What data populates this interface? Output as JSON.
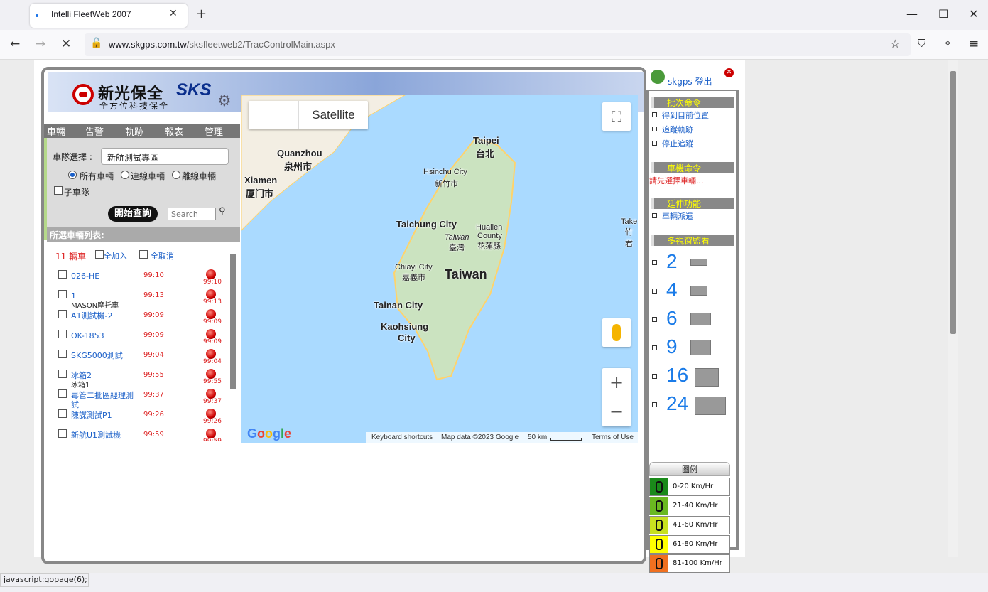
{
  "browser": {
    "tab_title": "Intelli FleetWeb 2007",
    "url_host": "www.skgps.com.tw",
    "url_path": "/sksfleetweb2/TracControlMain.aspx",
    "status_text": "javascript:gopage(6);"
  },
  "banner": {
    "logo_cn": "新光保全",
    "logo_en": "SKS",
    "logo_sub": "全方位科技保全"
  },
  "menu_tabs": [
    "車輛",
    "告警",
    "軌跡",
    "報表",
    "管理"
  ],
  "left": {
    "fleet_label": "車隊選擇 :",
    "fleet_value": "新航測試專區",
    "radio_all": "所有車輛",
    "radio_online": "連線車輛",
    "radio_offline": "離線車輛",
    "sub_fleet": "子車隊",
    "query_button": "開始查詢",
    "search_placeholder": "Search",
    "list_header": "所選車輛列表:",
    "count_text": "11 輛車",
    "add_all": "全加入",
    "cancel_all": "全取消"
  },
  "vehicles": [
    {
      "name": "026-HE",
      "sub": "",
      "time": "99:10"
    },
    {
      "name": "1",
      "sub": "MASON摩托車",
      "time": "99:13"
    },
    {
      "name": "A1測試機-2",
      "sub": "",
      "time": "99:09"
    },
    {
      "name": "OK-1853",
      "sub": "",
      "time": "99:09"
    },
    {
      "name": "SKG5000測試",
      "sub": "",
      "time": "99:04"
    },
    {
      "name": "冰箱2",
      "sub": "冰箱1",
      "time": "99:55"
    },
    {
      "name": "毒管二批區經理測試",
      "sub": "",
      "time": "99:37"
    },
    {
      "name": "陳謀測試P1",
      "sub": "",
      "time": "99:26"
    },
    {
      "name": "新航U1測試機",
      "sub": "",
      "time": "99:59"
    }
  ],
  "map": {
    "type_button": "Satellite",
    "labels": {
      "taipei": "Taipei",
      "taipei_cn": "台北",
      "quanzhou": "Quanzhou",
      "quanzhou_cn": "泉州市",
      "xiamen": "Xiamen",
      "xiamen_cn": "厦门市",
      "hsinchu": "Hsinchu City",
      "hsinchu_cn": "新竹市",
      "taichung": "Taichung City",
      "taiwan_small": "Taiwan",
      "taiwan_cn": "臺灣",
      "hualien": "Hualien",
      "hualien2": "County",
      "hualien_cn": "花蓮縣",
      "chiayi": "Chiayi City",
      "chiayi_cn": "嘉義市",
      "taiwan": "Taiwan",
      "tainan": "Tainan City",
      "kaohsiung": "Kaohsiung",
      "kaohsiung2": "City",
      "take": "Take",
      "take_cn": "竹君"
    },
    "footer": {
      "shortcuts": "Keyboard shortcuts",
      "data": "Map data ©2023 Google",
      "scale": "50 km",
      "terms": "Terms of Use"
    },
    "google": "Google"
  },
  "right": {
    "user": "skgps 登出",
    "batch_head": "批次命令",
    "batch_items": [
      "得到目前位置",
      "追蹤軌跡",
      "停止追蹤"
    ],
    "device_head": "車機命令",
    "device_hint": "請先選擇車輛...",
    "ext_head": "延伸功能",
    "ext_items": [
      "車輛派遣"
    ],
    "multi_head": "多視窗監看",
    "multi_counts": [
      "2",
      "4",
      "6",
      "9",
      "16",
      "24"
    ],
    "legend_head": "圖例",
    "legend": [
      {
        "label": "0-20 Km/Hr",
        "color": "#1a8a1a"
      },
      {
        "label": "21-40 Km/Hr",
        "color": "#6ab820"
      },
      {
        "label": "41-60 Km/Hr",
        "color": "#c8e020"
      },
      {
        "label": "61-80 Km/Hr",
        "color": "#ffff00"
      },
      {
        "label": "81-100 Km/Hr",
        "color": "#f07020"
      }
    ]
  }
}
